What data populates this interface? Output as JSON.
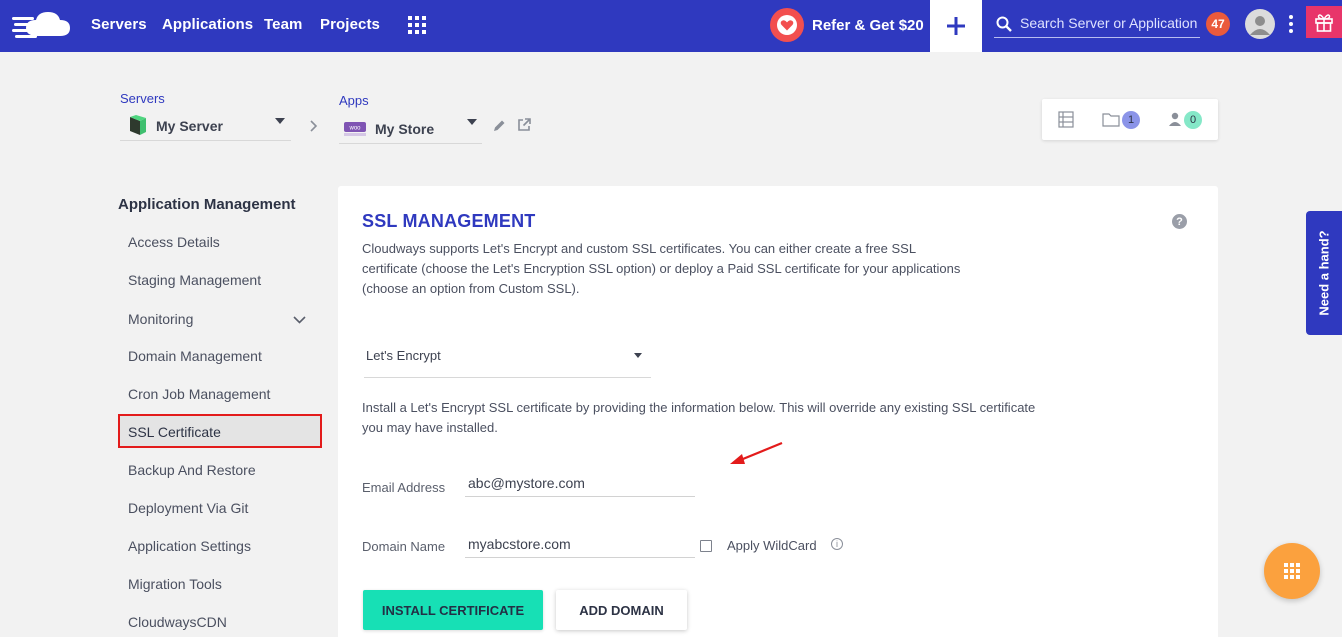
{
  "nav": {
    "items": [
      {
        "label": "Servers"
      },
      {
        "label": "Applications"
      },
      {
        "label": "Team"
      },
      {
        "label": "Projects"
      }
    ],
    "refer_label": "Refer & Get $20",
    "search_placeholder": "Search Server or Application",
    "notification_count": "47"
  },
  "breadcrumb": {
    "servers_label": "Servers",
    "server_name": "My Server",
    "apps_label": "Apps",
    "app_name": "My Store"
  },
  "toolbar": {
    "folder_count": "1",
    "users_count": "0"
  },
  "sidebar": {
    "title": "Application Management",
    "items": [
      {
        "label": "Access Details"
      },
      {
        "label": "Staging Management"
      },
      {
        "label": "Monitoring"
      },
      {
        "label": "Domain Management"
      },
      {
        "label": "Cron Job Management"
      },
      {
        "label": "SSL Certificate"
      },
      {
        "label": "Backup And Restore"
      },
      {
        "label": "Deployment Via Git"
      },
      {
        "label": "Application Settings"
      },
      {
        "label": "Migration Tools"
      },
      {
        "label": "CloudwaysCDN"
      }
    ]
  },
  "ssl": {
    "title": "SSL MANAGEMENT",
    "description": "Cloudways supports Let's Encrypt and custom SSL certificates. You can either create a free SSL certificate (choose the Let's Encryption SSL option) or deploy a Paid SSL certificate for your applications (choose an option from Custom SSL).",
    "provider": "Let's Encrypt",
    "instructions": "Install a Let's Encrypt SSL certificate by providing the information below. This will override any existing SSL certificate you may have installed.",
    "email_label": "Email Address",
    "email_value": "abc@mystore.com",
    "domain_label": "Domain Name",
    "domain_value": "myabcstore.com",
    "wildcard_label": "Apply WildCard",
    "install_label": "INSTALL CERTIFICATE",
    "add_domain_label": "ADD DOMAIN"
  },
  "help": {
    "need_hand_label": "Need a hand?"
  },
  "colors": {
    "brand": "#2f39bf",
    "install_button": "#17e0b5",
    "highlight_border": "#e31b1b",
    "fab": "#fba13e"
  },
  "icons": [
    "cloudways-logo-icon",
    "apps-grid-icon",
    "heart-icon",
    "plus-icon",
    "search-icon",
    "user-avatar-icon",
    "kebab-icon",
    "gift-icon",
    "server-icon",
    "woocommerce-icon",
    "pencil-icon",
    "external-link-icon",
    "list-icon",
    "folder-icon",
    "users-icon",
    "chevron-down-icon",
    "help-icon",
    "info-icon",
    "grid-icon",
    "arrow-icon"
  ]
}
